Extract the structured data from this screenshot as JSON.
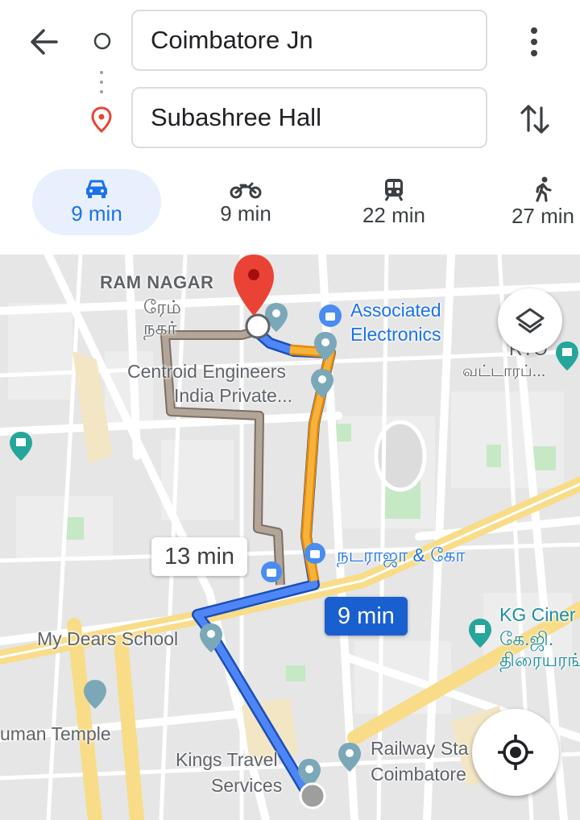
{
  "header": {
    "origin": "Coimbatore Jn",
    "destination": "Subashree Hall"
  },
  "modes": [
    {
      "icon": "car-icon",
      "time": "9 min",
      "active": true
    },
    {
      "icon": "motorcycle-icon",
      "time": "9 min",
      "active": false
    },
    {
      "icon": "train-icon",
      "time": "22 min",
      "active": false
    },
    {
      "icon": "walk-icon",
      "time": "27 min",
      "active": false
    }
  ],
  "map": {
    "route_chip_alt": "13 min",
    "route_chip_main": "9 min",
    "labels": {
      "ram_nagar": "RAM NAGAR",
      "ram_nagar_ta1": "ரேம்",
      "ram_nagar_ta2": "நகர்",
      "associated1": "Associated",
      "associated2": "Electronics",
      "rto1": "RTO",
      "rto2": "வட்டாரப்...",
      "centroid1": "Centroid Engineers",
      "centroid2": "India Private...",
      "nataraja": "நடராஜா & கோ",
      "kg1": "KG Ciner",
      "kg2": "கே.ஜி.",
      "kg3": "திரையரங்",
      "mydears": "My Dears School",
      "temple": "uman Temple",
      "kings1": "Kings Travel",
      "kings2": "Services",
      "railway1": "Railway Sta",
      "railway2": "Coimbatore"
    },
    "colors": {
      "route_primary": "#4f86f7",
      "route_traffic": "#f6a623",
      "route_alt": "#a89b8f",
      "destination_pin": "#ea4335"
    }
  }
}
